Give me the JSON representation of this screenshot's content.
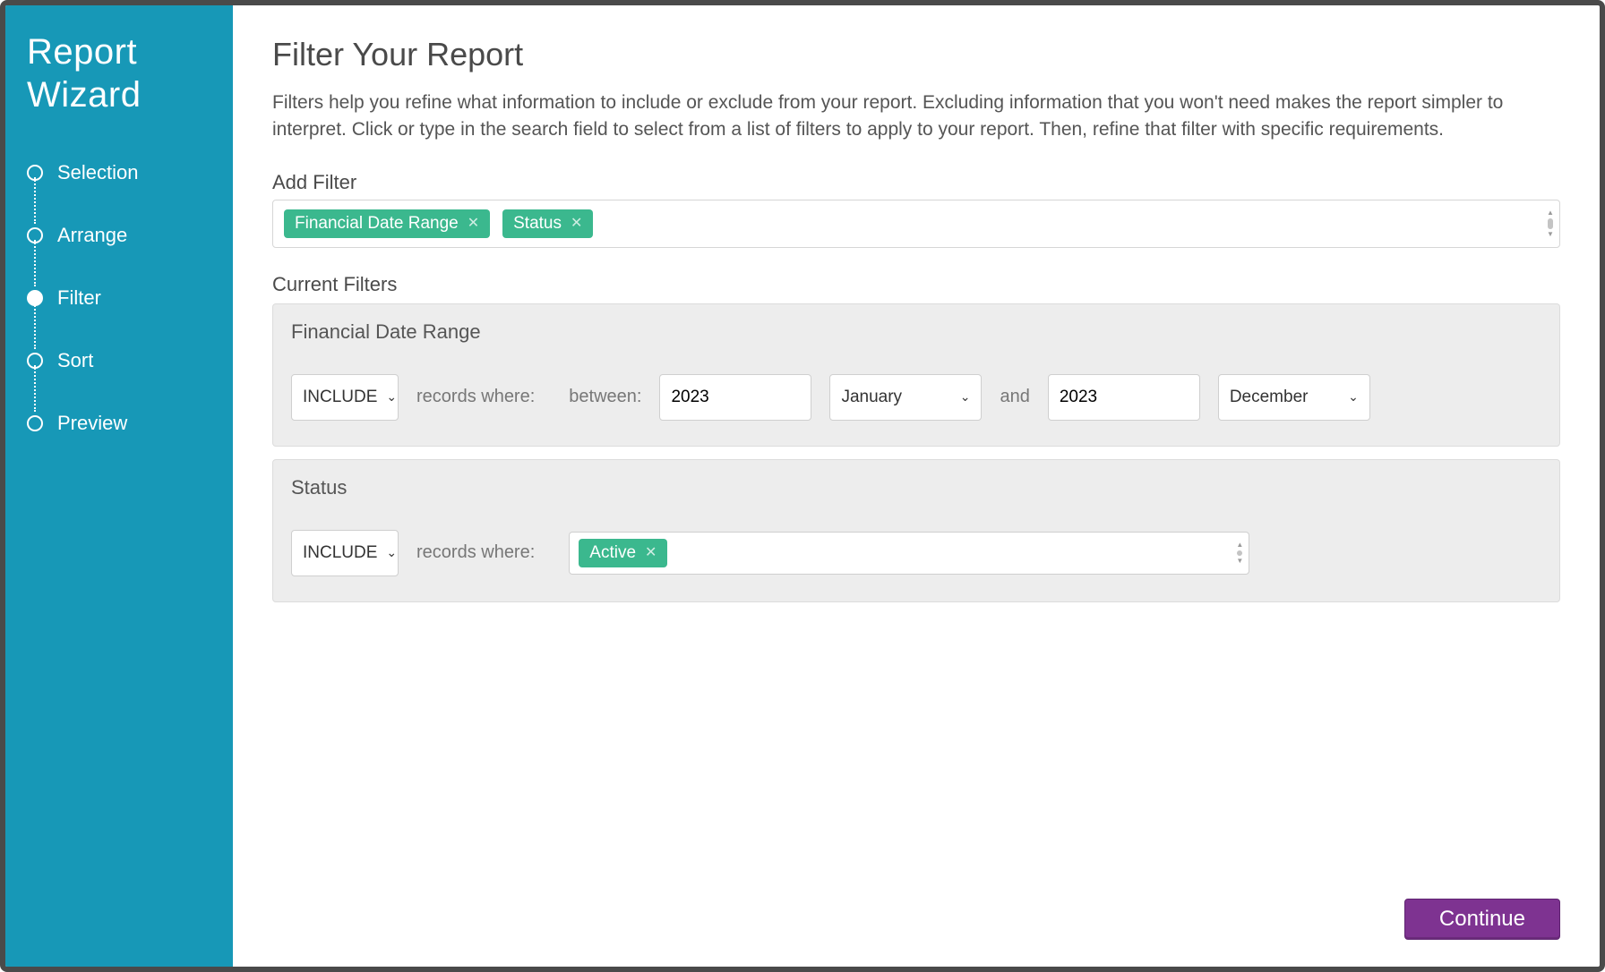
{
  "sidebar": {
    "title": "Report Wizard",
    "steps": [
      {
        "label": "Selection",
        "active": false
      },
      {
        "label": "Arrange",
        "active": false
      },
      {
        "label": "Filter",
        "active": true
      },
      {
        "label": "Sort",
        "active": false
      },
      {
        "label": "Preview",
        "active": false
      }
    ]
  },
  "page": {
    "title": "Filter Your Report",
    "description": "Filters help you refine what information to include or exclude from your report. Excluding information that you won't need makes the report simpler to interpret. Click or type in the search field to select from a list of filters to apply to your report. Then, refine that filter with specific requirements."
  },
  "add_filter": {
    "label": "Add Filter",
    "chips": [
      {
        "label": "Financial Date Range"
      },
      {
        "label": "Status"
      }
    ]
  },
  "current_filters": {
    "label": "Current Filters",
    "items": [
      {
        "title": "Financial Date Range",
        "mode": "INCLUDE",
        "records_where": "records where:",
        "between_label": "between:",
        "from_year": "2023",
        "from_month": "January",
        "and_label": "and",
        "to_year": "2023",
        "to_month": "December"
      },
      {
        "title": "Status",
        "mode": "INCLUDE",
        "records_where": "records where:",
        "value_chips": [
          {
            "label": "Active"
          }
        ]
      }
    ]
  },
  "footer": {
    "continue": "Continue"
  }
}
